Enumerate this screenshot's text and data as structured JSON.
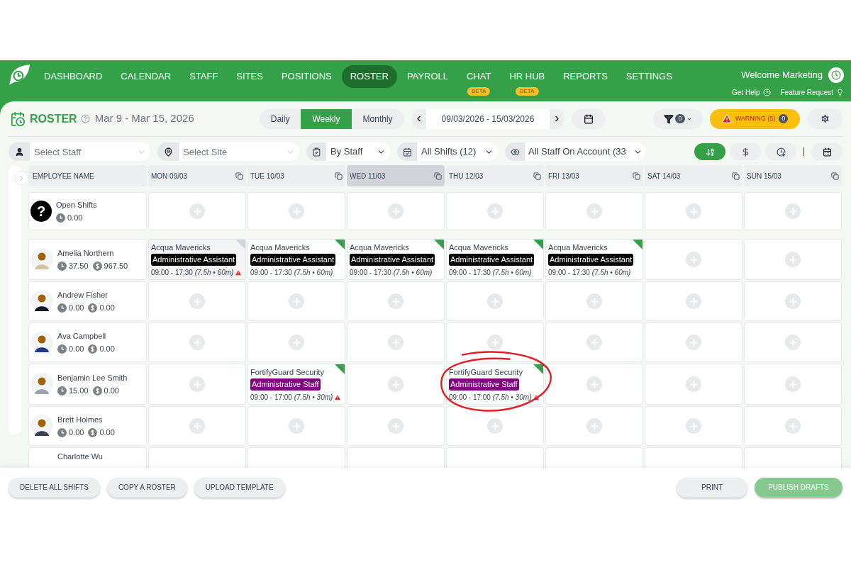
{
  "nav": {
    "items": [
      {
        "label": "DASHBOARD",
        "selected": false
      },
      {
        "label": "CALENDAR",
        "selected": false
      },
      {
        "label": "STAFF",
        "selected": false
      },
      {
        "label": "SITES",
        "selected": false
      },
      {
        "label": "POSITIONS",
        "selected": false
      },
      {
        "label": "ROSTER",
        "selected": true
      },
      {
        "label": "PAYROLL",
        "selected": false
      },
      {
        "label": "CHAT",
        "selected": false,
        "badge": "BETA"
      },
      {
        "label": "HR HUB",
        "selected": false,
        "badge": "BETA"
      },
      {
        "label": "REPORTS",
        "selected": false
      },
      {
        "label": "SETTINGS",
        "selected": false
      }
    ],
    "welcome": "Welcome Marketing",
    "help": "Get Help",
    "feature_request": "Feature Request"
  },
  "header": {
    "title": "ROSTER",
    "date_range": "Mar 9 - Mar 15, 2026",
    "views": [
      {
        "label": "Daily",
        "selected": false
      },
      {
        "label": "Weekly",
        "selected": true
      },
      {
        "label": "Monthly",
        "selected": false
      }
    ],
    "date_field": "09/03/2026 - 15/03/2026",
    "filter_count": "0",
    "warning": {
      "label": "WARNING (5)",
      "count": "0"
    }
  },
  "filters": {
    "staff": {
      "placeholder": "Select Staff"
    },
    "site": {
      "placeholder": "Select Site"
    },
    "group_by": "By Staff",
    "shifts": "All Shifts (12)",
    "staff_view": "All Staff On Account (33",
    "sort_buttons": [
      {
        "kind": "alpha",
        "selected": true
      },
      {
        "kind": "cost",
        "selected": false
      },
      {
        "kind": "time",
        "selected": false
      }
    ]
  },
  "table": {
    "first_column": "EMPLOYEE NAME",
    "days": [
      {
        "label": "MON 09/03",
        "today": false
      },
      {
        "label": "TUE 10/03",
        "today": false
      },
      {
        "label": "WED 11/03",
        "today": true
      },
      {
        "label": "THU 12/03",
        "today": false
      },
      {
        "label": "FRI 13/03",
        "today": false
      },
      {
        "label": "SAT 14/03",
        "today": false
      },
      {
        "label": "SUN 15/03",
        "today": false
      }
    ],
    "rows": [
      {
        "kind": "open",
        "name": "Open Shifts",
        "glyph": "?",
        "hours": "0.00",
        "cells": [
          {
            "kind": "empty"
          },
          {
            "kind": "empty"
          },
          {
            "kind": "empty"
          },
          {
            "kind": "empty"
          },
          {
            "kind": "empty"
          },
          {
            "kind": "empty"
          },
          {
            "kind": "empty"
          }
        ]
      },
      {
        "kind": "staff",
        "name": "Amelia Northern",
        "hours": "37.50",
        "cost": "967.50",
        "cells": [
          {
            "kind": "shift",
            "site": "Acqua Mavericks",
            "position": "Administrative Assistant",
            "color": "#000000",
            "time": "09:00 - 17:30",
            "duration": "(7.5h • 60m)",
            "published": false,
            "warning": true,
            "circled": false
          },
          {
            "kind": "shift",
            "site": "Acqua Mavericks",
            "position": "Administrative Assistant",
            "color": "#000000",
            "time": "09:00 - 17:30",
            "duration": "(7.5h • 60m)",
            "published": true,
            "warning": false,
            "circled": false
          },
          {
            "kind": "shift",
            "site": "Acqua Mavericks",
            "position": "Administrative Assistant",
            "color": "#000000",
            "time": "09:00 - 17:30",
            "duration": "(7.5h • 60m)",
            "published": true,
            "warning": false,
            "circled": false
          },
          {
            "kind": "shift",
            "site": "Acqua Mavericks",
            "position": "Administrative Assistant",
            "color": "#000000",
            "time": "09:00 - 17:30",
            "duration": "(7.5h • 60m)",
            "published": true,
            "warning": false,
            "circled": false
          },
          {
            "kind": "shift",
            "site": "Acqua Mavericks",
            "position": "Administrative Assistant",
            "color": "#000000",
            "time": "09:00 - 17:30",
            "duration": "(7.5h • 60m)",
            "published": true,
            "warning": false,
            "circled": false
          },
          {
            "kind": "empty"
          },
          {
            "kind": "empty"
          }
        ]
      },
      {
        "kind": "staff",
        "name": "Andrew Fisher",
        "hours": "0.00",
        "cost": "0.00",
        "cells": [
          {
            "kind": "empty"
          },
          {
            "kind": "empty"
          },
          {
            "kind": "empty"
          },
          {
            "kind": "empty"
          },
          {
            "kind": "empty"
          },
          {
            "kind": "empty"
          },
          {
            "kind": "empty"
          }
        ]
      },
      {
        "kind": "staff",
        "name": "Ava Campbell",
        "hours": "0.00",
        "cost": "0.00",
        "cells": [
          {
            "kind": "empty"
          },
          {
            "kind": "empty"
          },
          {
            "kind": "empty"
          },
          {
            "kind": "empty"
          },
          {
            "kind": "empty"
          },
          {
            "kind": "empty"
          },
          {
            "kind": "empty"
          }
        ]
      },
      {
        "kind": "staff",
        "name": "Benjamin Lee Smith",
        "hours": "15.00",
        "cost": "0.00",
        "cells": [
          {
            "kind": "empty"
          },
          {
            "kind": "shift",
            "site": "FortifyGuard Security",
            "position": "Administrative Staff",
            "color": "#800080",
            "time": "09:00 - 17:00",
            "duration": "(7.5h • 30m)",
            "published": true,
            "warning": true,
            "circled": false
          },
          {
            "kind": "empty"
          },
          {
            "kind": "shift",
            "site": "FortifyGuard Security",
            "position": "Administrative Staff",
            "color": "#800080",
            "time": "09:00 - 17:00",
            "duration": "(7.5h • 30m)",
            "published": true,
            "warning": true,
            "circled": true
          },
          {
            "kind": "empty"
          },
          {
            "kind": "empty"
          },
          {
            "kind": "empty"
          }
        ]
      },
      {
        "kind": "staff",
        "name": "Brett Holmes",
        "hours": "0.00",
        "cost": "0.00",
        "cells": [
          {
            "kind": "empty"
          },
          {
            "kind": "empty"
          },
          {
            "kind": "empty"
          },
          {
            "kind": "empty"
          },
          {
            "kind": "empty"
          },
          {
            "kind": "empty"
          },
          {
            "kind": "empty"
          }
        ]
      },
      {
        "kind": "partial",
        "name": "Charlotte Wu",
        "cells": [
          {
            "kind": "blank"
          },
          {
            "kind": "blank"
          },
          {
            "kind": "blank"
          },
          {
            "kind": "blank"
          },
          {
            "kind": "blank"
          },
          {
            "kind": "blank"
          },
          {
            "kind": "blank"
          }
        ]
      }
    ]
  },
  "footer": {
    "left": [
      {
        "label": "DELETE ALL SHIFTS",
        "disabled": false
      },
      {
        "label": "COPY A ROSTER",
        "disabled": false
      },
      {
        "label": "UPLOAD TEMPLATE",
        "disabled": false
      }
    ],
    "right": [
      {
        "label": "PRINT",
        "disabled": false,
        "kind": "plain"
      },
      {
        "label": "PUBLISH DRAFTS",
        "disabled": true,
        "kind": "primary"
      }
    ]
  }
}
